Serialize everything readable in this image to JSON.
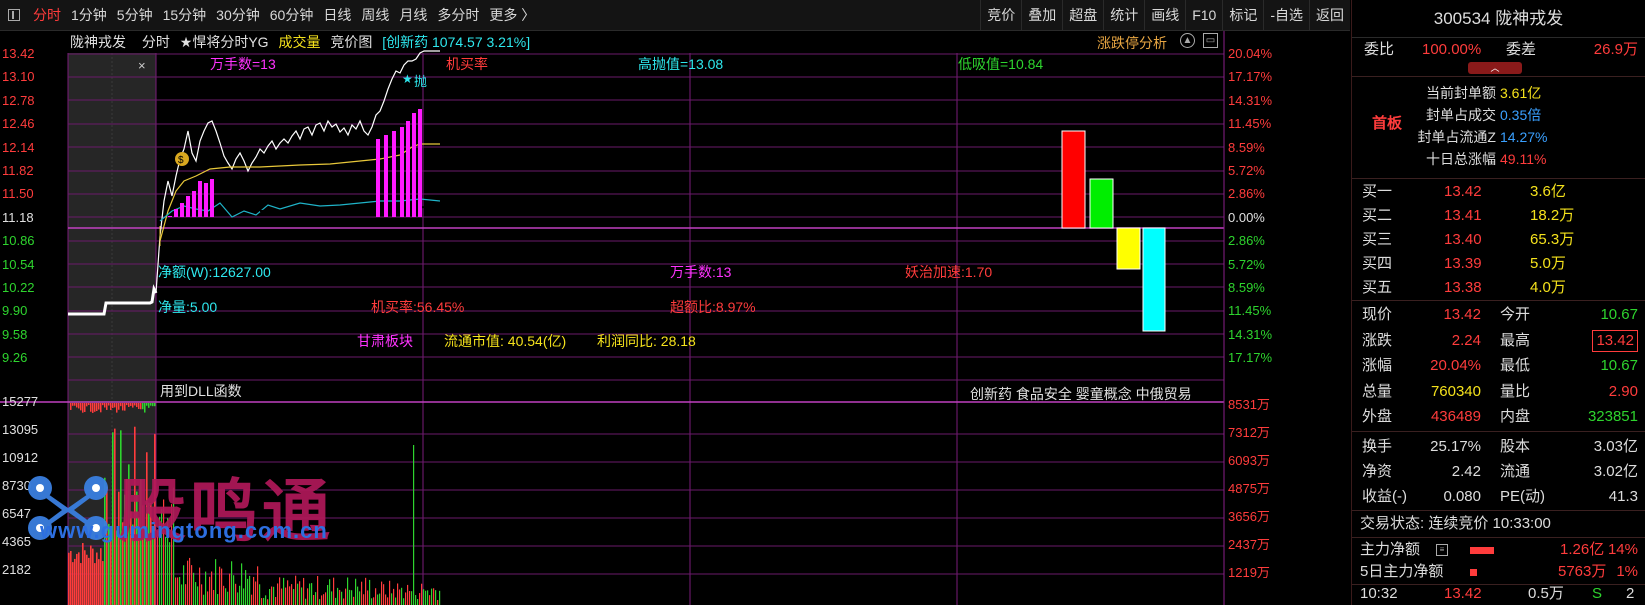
{
  "toolbar": {
    "tabs": [
      "分时",
      "1分钟",
      "5分钟",
      "15分钟",
      "30分钟",
      "60分钟",
      "日线",
      "周线",
      "月线",
      "多分时",
      "更多 〉"
    ],
    "right_buttons": [
      "竞价",
      "叠加",
      "超盘",
      "统计",
      "画线",
      "F10",
      "标记",
      "-自选",
      "返回"
    ]
  },
  "chart_header": {
    "stock_name": "陇神戎发",
    "mode": "分时",
    "indicator": "★悍将分时YG",
    "volume_label": "成交量",
    "auction_label": "竞价图",
    "sector_info": "[创新药 1074.57 3.21%]",
    "limit_analysis": "涨跌停分析"
  },
  "price_axis": {
    "left": [
      "13.42",
      "13.10",
      "12.78",
      "12.46",
      "12.14",
      "11.82",
      "11.50",
      "11.18",
      "10.86",
      "10.54",
      "10.22",
      "9.90",
      "9.58",
      "9.26"
    ],
    "right": [
      "20.04%",
      "17.17%",
      "14.31%",
      "11.45%",
      "8.59%",
      "5.72%",
      "2.86%",
      "0.00%",
      "2.86%",
      "5.72%",
      "8.59%",
      "11.45%",
      "14.31%",
      "17.17%"
    ]
  },
  "volume_axis": {
    "left": [
      "15277",
      "13095",
      "10912",
      "8730",
      "6547",
      "4365",
      "2182"
    ],
    "right": [
      "8531万",
      "7312万",
      "6093万",
      "4875万",
      "3656万",
      "2437万",
      "1219万"
    ]
  },
  "annotations": {
    "wanshou_top": "万手数=13",
    "jimailv_top": "机买率",
    "gaopao": "高抛值=13.08",
    "dixi": "低吸值=10.84",
    "pao_mark": "抛",
    "net_amount": "净额(W):12627.00",
    "net_volume": "净量:5.00",
    "wanshou_mid": "万手数:13",
    "yaozhi": "妖治加速:1.70",
    "jimailv_mid": "机买率:56.45%",
    "chaoe": "超额比:8.97%",
    "sector": "甘肃板块",
    "float_cap": "流通市值:  40.54(亿)",
    "profit_yoy": "利润同比:  28.18",
    "dll_note": "用到DLL函数",
    "concepts": "创新药  食品安全  婴童概念  中俄贸易",
    "close_x": "×"
  },
  "colors": {
    "up": "#ff3c3c",
    "down": "#2ed42e",
    "grid": "#8a1f8a",
    "bg": "#000000"
  },
  "panel": {
    "code_name": "300534  陇神戎发",
    "weibi_label": "委比",
    "weibi_value": "100.00%",
    "weicha_label": "委差",
    "weicha_value": "26.9万",
    "shouban": "首板",
    "seal_rows": [
      {
        "label": "当前封单额",
        "value": "3.61亿",
        "color": "#f5e21c"
      },
      {
        "label": "封单占成交",
        "value": "0.35倍",
        "color": "#3aa0ff"
      },
      {
        "label": "封单占流通Z",
        "value": "14.27%",
        "color": "#3aa0ff"
      },
      {
        "label": "十日总涨幅",
        "value": "49.11%",
        "color": "#ff3c3c"
      }
    ],
    "bids": [
      {
        "label": "买一",
        "price": "13.42",
        "vol": "3.6亿"
      },
      {
        "label": "买二",
        "price": "13.41",
        "vol": "18.2万"
      },
      {
        "label": "买三",
        "price": "13.40",
        "vol": "65.3万"
      },
      {
        "label": "买四",
        "price": "13.39",
        "vol": "5.0万"
      },
      {
        "label": "买五",
        "price": "13.38",
        "vol": "4.0万"
      }
    ],
    "quote": [
      {
        "l1": "现价",
        "v1": "13.42",
        "c1": "#ff3c3c",
        "l2": "今开",
        "v2": "10.67",
        "c2": "#2ed42e"
      },
      {
        "l1": "涨跌",
        "v1": "2.24",
        "c1": "#ff3c3c",
        "l2": "最高",
        "v2": "13.42",
        "c2": "#ff3c3c"
      },
      {
        "l1": "涨幅",
        "v1": "20.04%",
        "c1": "#ff3c3c",
        "l2": "最低",
        "v2": "10.67",
        "c2": "#2ed42e"
      },
      {
        "l1": "总量",
        "v1": "760340",
        "c1": "#f5e21c",
        "l2": "量比",
        "v2": "2.90",
        "c2": "#ff3c3c"
      },
      {
        "l1": "外盘",
        "v1": "436489",
        "c1": "#ff3c3c",
        "l2": "内盘",
        "v2": "323851",
        "c2": "#2ed42e"
      }
    ],
    "fundamentals": [
      {
        "l1": "换手",
        "v1": "25.17%",
        "l2": "股本",
        "v2": "3.03亿"
      },
      {
        "l1": "净资",
        "v1": "2.42",
        "l2": "流通",
        "v2": "3.02亿"
      },
      {
        "l1": "收益(-)",
        "v1": "0.080",
        "l2": "PE(动)",
        "v2": "41.3"
      }
    ],
    "trade_status": "交易状态: 连续竞价 10:33:00",
    "main_net_label": "主力净额",
    "main_net_value": "1.26亿",
    "main_net_pct": "14%",
    "main5_label": "5日主力净额",
    "main5_value": "5763万",
    "main5_pct": "1%",
    "tick": {
      "time": "10:32",
      "price": "13.42",
      "vol": "0.5万",
      "flag": "S",
      "count": "2"
    }
  },
  "watermark": {
    "text": "股鸣通",
    "url": "www.gumingtong.com.cn"
  }
}
